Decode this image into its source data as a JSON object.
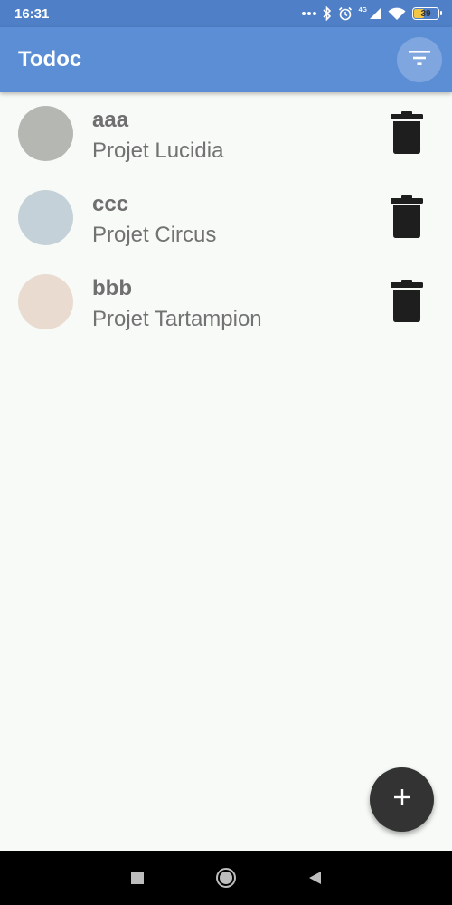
{
  "status_bar": {
    "time": "16:31",
    "battery": "39",
    "network": "4G",
    "icons": [
      "more-dots-icon",
      "bluetooth-icon",
      "alarm-icon",
      "signal-icon",
      "wifi-icon",
      "battery-icon"
    ]
  },
  "app_bar": {
    "title": "Todoc",
    "filter_icon": "filter-icon"
  },
  "tasks": [
    {
      "name": "aaa",
      "project": "Projet Lucidia",
      "color": "#b5b7b3"
    },
    {
      "name": "ccc",
      "project": "Projet Circus",
      "color": "#c5d1d8"
    },
    {
      "name": "bbb",
      "project": "Projet Tartampion",
      "color": "#eadbd1"
    }
  ],
  "task_action_icon": "trash-icon",
  "fab": {
    "icon": "plus-icon",
    "color": "#333333"
  },
  "nav_bar": {
    "icons": [
      "recents-square-icon",
      "home-circle-icon",
      "back-triangle-icon"
    ]
  },
  "colors": {
    "status_bar": "#4e7fc7",
    "app_bar": "#5b8ed5",
    "background": "#f7faf6"
  }
}
